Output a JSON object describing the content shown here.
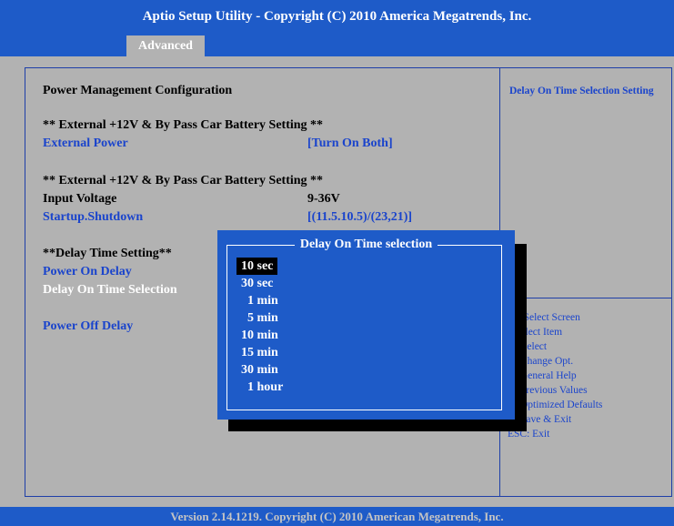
{
  "title": "Aptio Setup Utility - Copyright (C) 2010 America Megatrends, Inc.",
  "tabs": {
    "active": "Advanced"
  },
  "settings": {
    "heading": "Power Management Configuration",
    "section1": "** External +12V & By Pass Car Battery Setting **",
    "external_power_label": "External Power",
    "external_power_value": "[Turn On Both]",
    "section2": "** External +12V & By Pass Car Battery Setting **",
    "input_voltage_label": "Input Voltage",
    "input_voltage_value": "9-36V",
    "startup_label": "Startup.Shutdown",
    "startup_value": "[(11.5.10.5)/(23,21)]",
    "section3": "**Delay Time Setting**",
    "power_on_delay_label": "Power On Delay",
    "delay_on_time_label": "Delay On Time Selection",
    "power_off_delay_label": "Power Off Delay"
  },
  "help": {
    "title": "Delay On Time Selection Setting",
    "keys": [
      "←: Select Screen",
      "Select Item",
      "er: Select",
      "Change Opt.",
      "General Help",
      "Previous Values",
      "Optimized Defaults",
      "Save & Exit",
      "ESC: Exit"
    ]
  },
  "popup": {
    "title": "Delay On Time selection",
    "options": [
      "10 sec",
      "30 sec",
      "  1 min",
      "  5 min",
      "10 min",
      "15 min",
      "30 min",
      "  1 hour"
    ],
    "selected_index": 0
  },
  "footer": "Version 2.14.1219. Copyright (C) 2010 American Megatrends, Inc."
}
